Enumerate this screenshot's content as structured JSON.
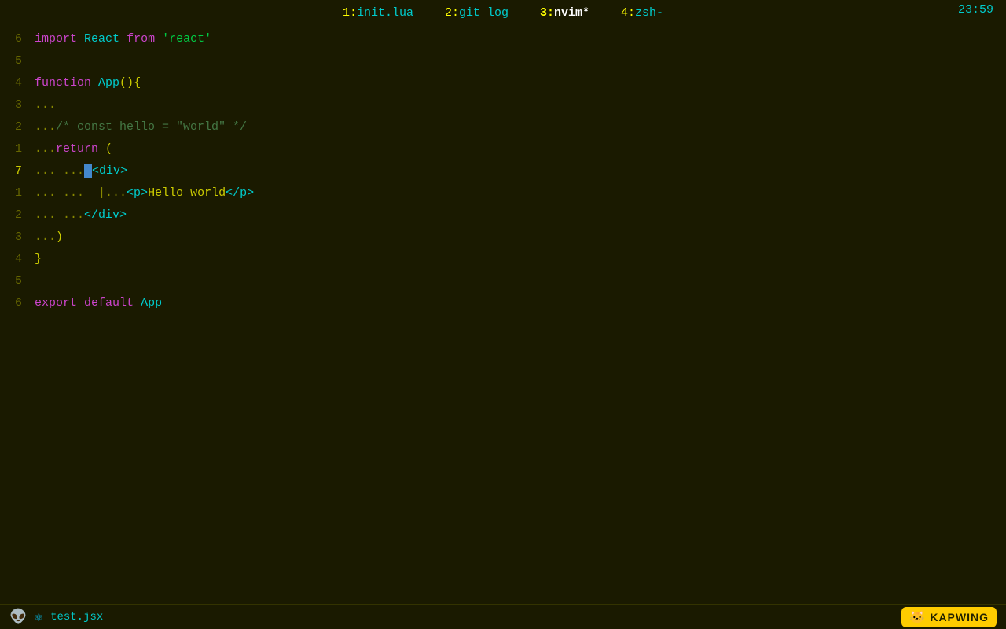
{
  "tabs": [
    {
      "id": "tab1",
      "number": "1",
      "name": "init.lua",
      "separator": ":",
      "active": false
    },
    {
      "id": "tab2",
      "number": "2",
      "name": "git log",
      "separator": ":",
      "active": false
    },
    {
      "id": "tab3",
      "number": "3",
      "name": "nvim*",
      "separator": ":",
      "active": true
    },
    {
      "id": "tab4",
      "number": "4",
      "name": "zsh-",
      "separator": ":",
      "active": false
    }
  ],
  "clock": "23:59",
  "code_lines": [
    {
      "num": "6",
      "active": false,
      "content": "import React from 'react'"
    },
    {
      "num": "5",
      "active": false,
      "content": ""
    },
    {
      "num": "4",
      "active": false,
      "content": "function App(){"
    },
    {
      "num": "3",
      "active": false,
      "content": "  ..."
    },
    {
      "num": "2",
      "active": false,
      "content": "  .../* const hello = \"world\" */"
    },
    {
      "num": "1",
      "active": false,
      "content": "  ...return ("
    },
    {
      "num": "7",
      "active": true,
      "content": "  ... ...<div>"
    },
    {
      "num": "1",
      "active": false,
      "content": "  ... ......<p>Hello world</p>"
    },
    {
      "num": "2",
      "active": false,
      "content": "  ... ...</div>"
    },
    {
      "num": "3",
      "active": false,
      "content": "  ...)"
    },
    {
      "num": "4",
      "active": false,
      "content": "}"
    },
    {
      "num": "5",
      "active": false,
      "content": ""
    },
    {
      "num": "6",
      "active": false,
      "content": "export default App"
    }
  ],
  "status": {
    "file_name": "test.jsx",
    "kapwing_text": "KAPWING"
  }
}
